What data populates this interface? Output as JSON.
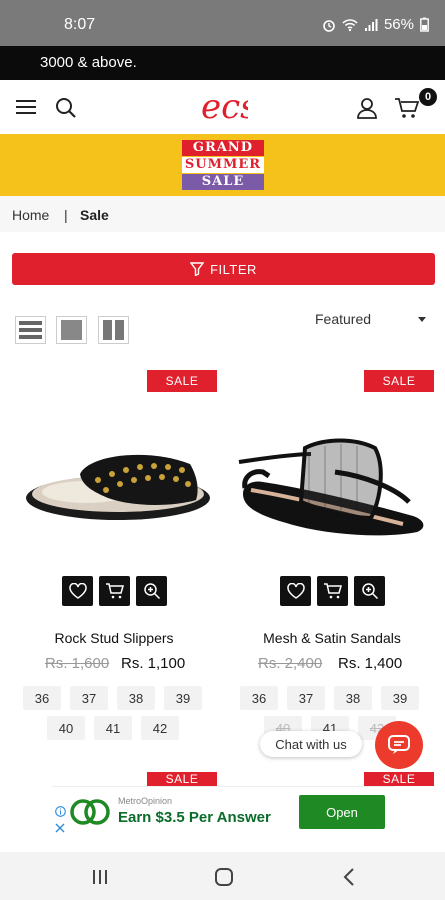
{
  "status_bar": {
    "time": "8:07",
    "battery": "56%"
  },
  "announcement": {
    "text": "3000 & above."
  },
  "header": {
    "logo_text": "ecs",
    "cart_count": "0"
  },
  "banner": {
    "line1": "GRAND",
    "line2": "SUMMER",
    "line3": "SALE"
  },
  "breadcrumb": {
    "home": "Home",
    "separator": "|",
    "current": "Sale"
  },
  "filter": {
    "label": "FILTER"
  },
  "sort": {
    "selected": "Featured"
  },
  "products": [
    {
      "badge": "SALE",
      "name": "Rock Stud Slippers",
      "old_price": "Rs. 1,600",
      "new_price": "Rs. 1,100",
      "sizes": [
        "36",
        "37",
        "38",
        "39",
        "40",
        "41",
        "42"
      ]
    },
    {
      "badge": "SALE",
      "name": "Mesh & Satin Sandals",
      "old_price": "Rs. 2,400",
      "new_price": "Rs. 1,400",
      "sizes": [
        "36",
        "37",
        "38",
        "39",
        "40",
        "41",
        "42"
      ]
    }
  ],
  "next_row_badges": [
    "SALE",
    "SALE"
  ],
  "chat": {
    "label": "Chat with us"
  },
  "ad": {
    "sponsor": "MetroOpinion",
    "title": "Earn $3.5 Per Answer",
    "cta": "Open"
  },
  "colors": {
    "brand_red": "#e0202d",
    "banner_yellow": "#f5c21b",
    "ad_green": "#1f8a23"
  }
}
